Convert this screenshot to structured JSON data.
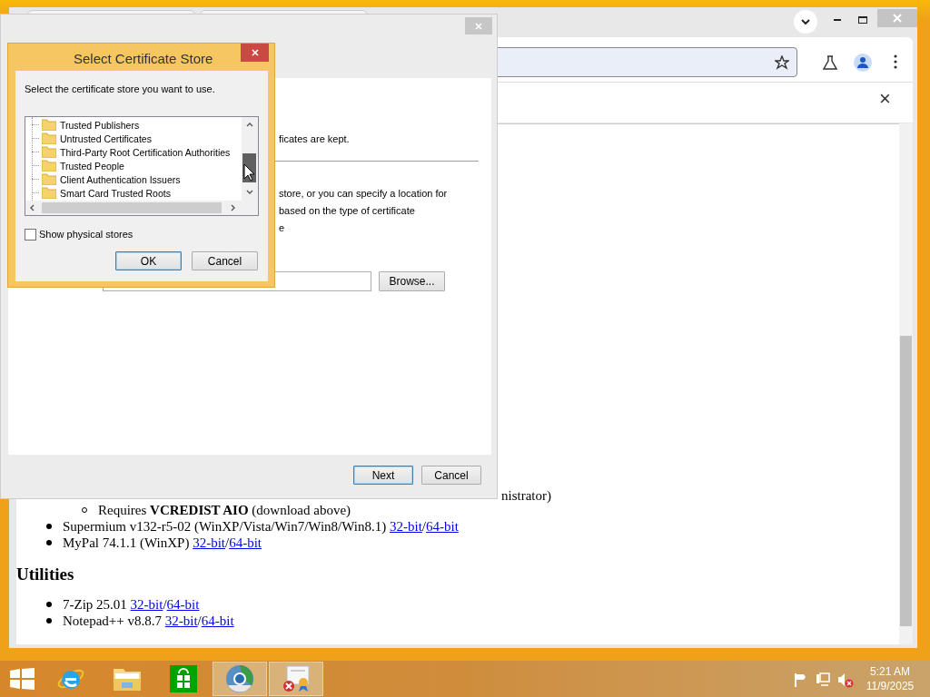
{
  "browser": {
    "infobar_close": "×",
    "page_lines": [
      {
        "kind": "fragment",
        "parts": [
          {
            "kind": "text",
            "text": "nistrator)"
          }
        ]
      },
      {
        "kind": "sub",
        "parts": [
          {
            "kind": "rich",
            "text": "Requires **VCREDIST AIO** (download above)"
          }
        ]
      },
      {
        "kind": "item",
        "parts": [
          {
            "kind": "text",
            "text": "Supermium v132-r5-02 (WinXP/Vista/Win7/Win8/Win8.1) "
          },
          {
            "kind": "link",
            "text": "32-bit"
          },
          {
            "kind": "text",
            "text": "/"
          },
          {
            "kind": "link",
            "text": "64-bit"
          }
        ]
      },
      {
        "kind": "item",
        "parts": [
          {
            "kind": "text",
            "text": "MyPal 74.1.1 (WinXP) "
          },
          {
            "kind": "link",
            "text": "32-bit"
          },
          {
            "kind": "text",
            "text": "/"
          },
          {
            "kind": "link",
            "text": "64-bit"
          }
        ]
      },
      {
        "kind": "heading",
        "text": "Utilities"
      },
      {
        "kind": "item",
        "parts": [
          {
            "kind": "text",
            "text": "7-Zip 25.01 "
          },
          {
            "kind": "link",
            "text": "32-bit"
          },
          {
            "kind": "text",
            "text": "/"
          },
          {
            "kind": "link",
            "text": "64-bit"
          }
        ]
      },
      {
        "kind": "item",
        "parts": [
          {
            "kind": "text",
            "text": "Notepad++ v8.8.7 "
          },
          {
            "kind": "link",
            "text": "32-bit"
          },
          {
            "kind": "text",
            "text": "/"
          },
          {
            "kind": "link",
            "text": "64-bit"
          }
        ]
      }
    ]
  },
  "wizard": {
    "fragments": [
      {
        "kind": "text",
        "text": "ficates are kept."
      },
      {
        "kind": "rule"
      },
      {
        "kind": "text",
        "text": "store, or you can specify a location for"
      },
      {
        "kind": "text",
        "text": "based on the type of certificate"
      },
      {
        "kind": "text",
        "text": "e"
      }
    ],
    "browse": "Browse...",
    "buttons": [
      {
        "label": "Next",
        "default": true
      },
      {
        "label": "Cancel",
        "default": false
      }
    ]
  },
  "dialog": {
    "title": "Select Certificate Store",
    "instruction": "Select the certificate store you want to use.",
    "stores": [
      "Trusted Publishers",
      "Untrusted Certificates",
      "Third-Party Root Certification Authorities",
      "Trusted People",
      "Client Authentication Issuers",
      "Smart Card Trusted Roots"
    ],
    "show_physical": {
      "label": "Show physical stores",
      "checked": false
    },
    "buttons": [
      {
        "label": "OK",
        "default": true
      },
      {
        "label": "Cancel",
        "default": false
      }
    ]
  },
  "taskbar": {
    "apps": [
      {
        "kind": "ie",
        "selected": false
      },
      {
        "kind": "explorer",
        "selected": false
      },
      {
        "kind": "store",
        "selected": false
      },
      {
        "kind": "chromium",
        "selected": true
      },
      {
        "kind": "certificate",
        "selected": true
      }
    ],
    "time": "5:21 AM",
    "date": "11/9/2025"
  }
}
